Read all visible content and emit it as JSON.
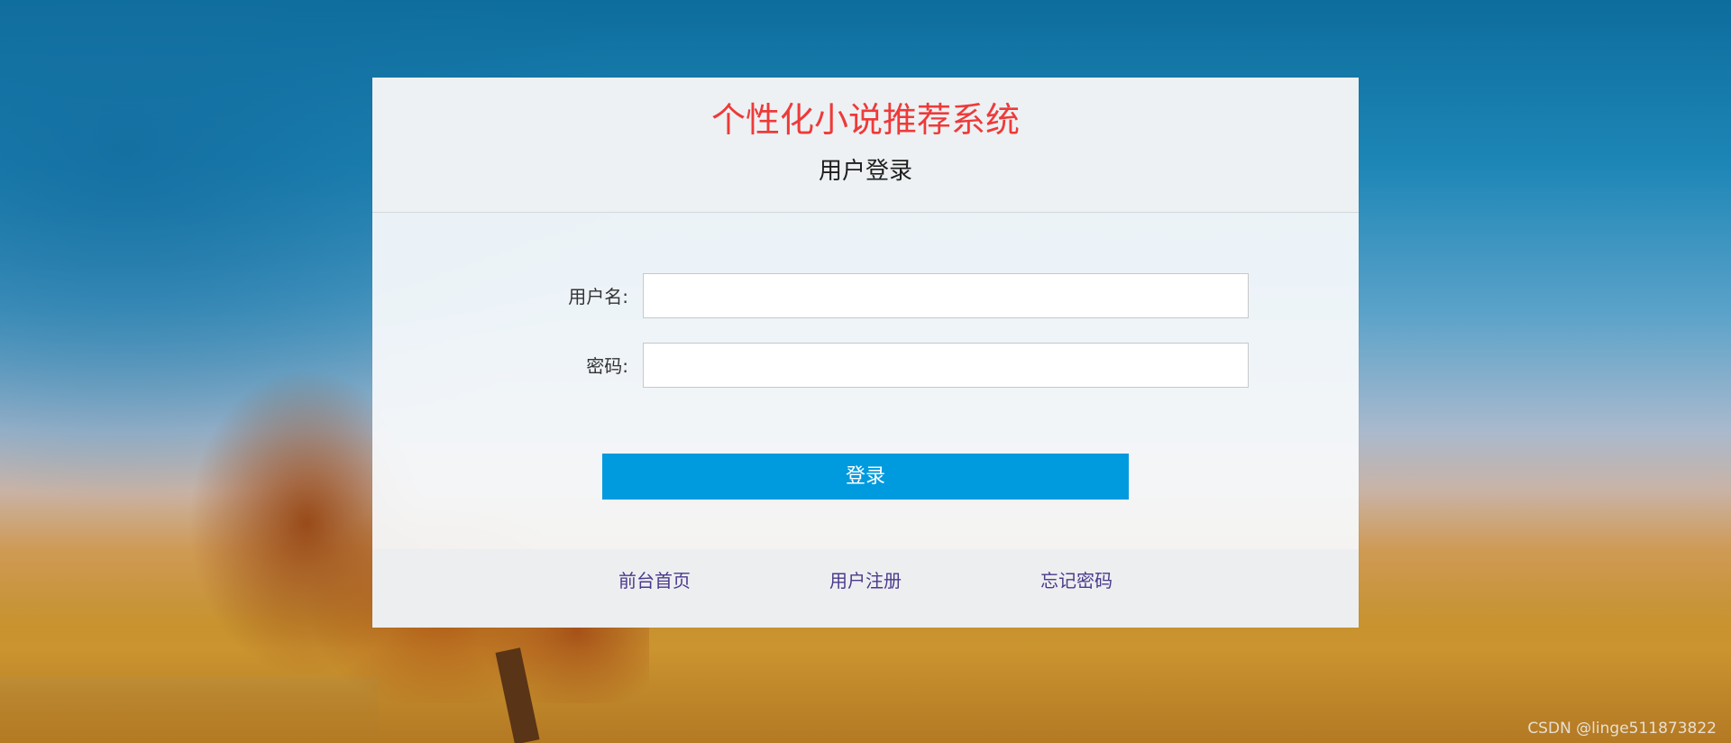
{
  "header": {
    "system_title": "个性化小说推荐系统",
    "subtitle": "用户登录"
  },
  "form": {
    "username_label": "用户名:",
    "username_value": "",
    "password_label": "密码:",
    "password_value": "",
    "login_button_label": "登录"
  },
  "footer": {
    "links": [
      {
        "label": "前台首页"
      },
      {
        "label": "用户注册"
      },
      {
        "label": "忘记密码"
      }
    ]
  },
  "watermark": "CSDN @linge511873822",
  "colors": {
    "title_red": "#ee3a3a",
    "button_blue": "#009ade",
    "link_purple": "#4a3a8c"
  }
}
